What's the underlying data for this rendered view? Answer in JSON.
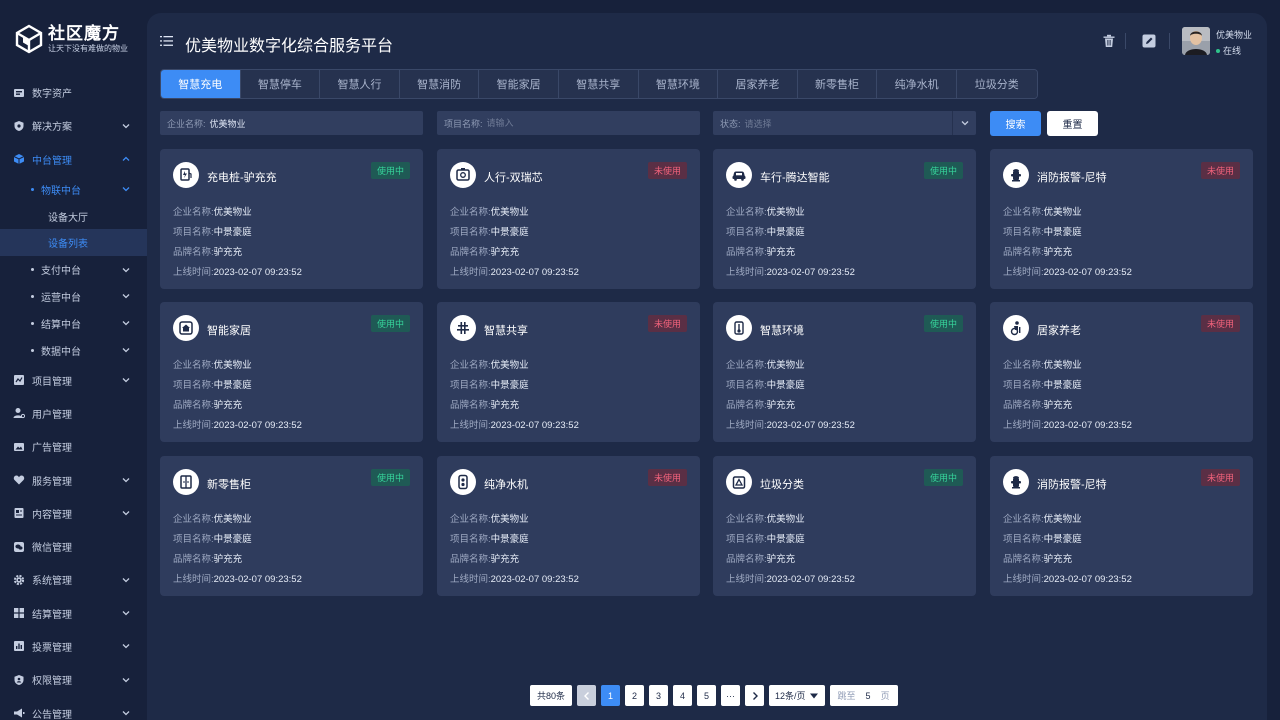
{
  "logo": {
    "title": "社区魔方",
    "subtitle": "让天下没有难做的物业"
  },
  "nav": {
    "item1": "数字资产",
    "item2": "解决方案",
    "item3": "中台管理",
    "sub_iot": "物联中台",
    "leaf_hall": "设备大厅",
    "leaf_list": "设备列表",
    "sub_pay": "支付中台",
    "sub_ops": "运营中台",
    "sub_settle": "结算中台",
    "sub_data": "数据中台",
    "item4": "项目管理",
    "item5": "用户管理",
    "item6": "广告管理",
    "item7": "服务管理",
    "item8": "内容管理",
    "item9": "微信管理",
    "item10": "系统管理",
    "item11": "结算管理",
    "item12": "投票管理",
    "item13": "权限管理",
    "item14": "公告管理"
  },
  "header": {
    "title": "优美物业数字化综合服务平台",
    "user_name": "优美物业",
    "user_status": "在线"
  },
  "tabs": [
    "智慧充电",
    "智慧停车",
    "智慧人行",
    "智慧消防",
    "智能家居",
    "智慧共享",
    "智慧环境",
    "居家养老",
    "新零售柜",
    "纯净水机",
    "垃圾分类"
  ],
  "filters": {
    "company_label": "企业名称:",
    "company_value": "优美物业",
    "project_label": "项目名称:",
    "project_placeholder": "请输入",
    "status_label": "状态:",
    "status_placeholder": "请选择",
    "search": "搜索",
    "reset": "重置"
  },
  "field_labels": {
    "company": "企业名称:",
    "project": "项目名称:",
    "brand": "品牌名称:",
    "online": "上线时间:"
  },
  "cards": [
    {
      "title": "充电桩-驴充充",
      "status": "使用中",
      "company": "优美物业",
      "project": "中景豪庭",
      "brand": "驴充充",
      "time": "2023-02-07 09:23:52"
    },
    {
      "title": "人行-双瑞芯",
      "status": "未使用",
      "company": "优美物业",
      "project": "中景豪庭",
      "brand": "驴充充",
      "time": "2023-02-07 09:23:52"
    },
    {
      "title": "车行-腾达智能",
      "status": "使用中",
      "company": "优美物业",
      "project": "中景豪庭",
      "brand": "驴充充",
      "time": "2023-02-07 09:23:52"
    },
    {
      "title": "消防报警-尼特",
      "status": "未使用",
      "company": "优美物业",
      "project": "中景豪庭",
      "brand": "驴充充",
      "time": "2023-02-07 09:23:52"
    },
    {
      "title": "智能家居",
      "status": "使用中",
      "company": "优美物业",
      "project": "中景豪庭",
      "brand": "驴充充",
      "time": "2023-02-07 09:23:52"
    },
    {
      "title": "智慧共享",
      "status": "未使用",
      "company": "优美物业",
      "project": "中景豪庭",
      "brand": "驴充充",
      "time": "2023-02-07 09:23:52"
    },
    {
      "title": "智慧环境",
      "status": "使用中",
      "company": "优美物业",
      "project": "中景豪庭",
      "brand": "驴充充",
      "time": "2023-02-07 09:23:52"
    },
    {
      "title": "居家养老",
      "status": "未使用",
      "company": "优美物业",
      "project": "中景豪庭",
      "brand": "驴充充",
      "time": "2023-02-07 09:23:52"
    },
    {
      "title": "新零售柜",
      "status": "使用中",
      "company": "优美物业",
      "project": "中景豪庭",
      "brand": "驴充充",
      "time": "2023-02-07 09:23:52"
    },
    {
      "title": "纯净水机",
      "status": "未使用",
      "company": "优美物业",
      "project": "中景豪庭",
      "brand": "驴充充",
      "time": "2023-02-07 09:23:52"
    },
    {
      "title": "垃圾分类",
      "status": "使用中",
      "company": "优美物业",
      "project": "中景豪庭",
      "brand": "驴充充",
      "time": "2023-02-07 09:23:52"
    },
    {
      "title": "消防报警-尼特",
      "status": "未使用",
      "company": "优美物业",
      "project": "中景豪庭",
      "brand": "驴充充",
      "time": "2023-02-07 09:23:52"
    }
  ],
  "pagination": {
    "total": "共80条",
    "pages": [
      "1",
      "2",
      "3",
      "4",
      "5"
    ],
    "ellipsis": "···",
    "page_size": "12条/页",
    "jump_label": "跳至",
    "jump_value": "5",
    "jump_unit": "页"
  },
  "colors": {
    "accent": "#3d8cf5",
    "in_use": "#36d39a",
    "unused": "#f0627b",
    "panel": "#1e2a47",
    "card": "#2f3c5d"
  }
}
